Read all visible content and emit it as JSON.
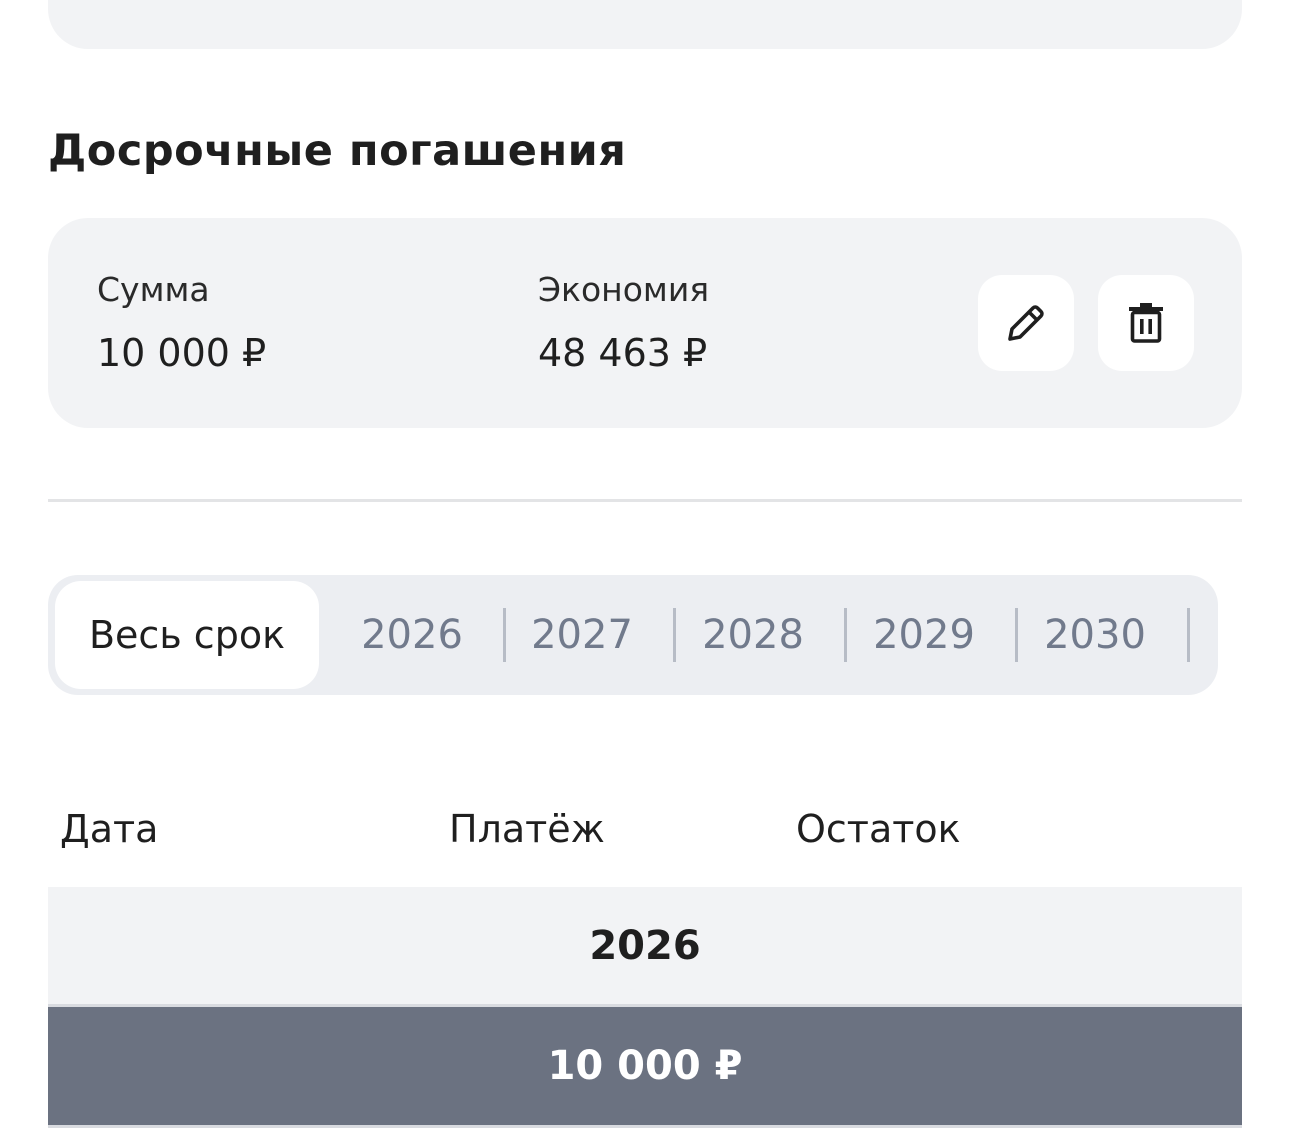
{
  "early_repayments": {
    "title": "Досрочные погашения",
    "card": {
      "sum_label": "Сумма",
      "sum_value": "10 000 ₽",
      "savings_label": "Экономия",
      "savings_value": "48 463 ₽",
      "edit_icon": "pencil-icon",
      "delete_icon": "trash-icon"
    }
  },
  "period_tabs": {
    "active": "Весь срок",
    "years": [
      "2026",
      "2027",
      "2028",
      "2029",
      "2030"
    ]
  },
  "schedule_table": {
    "headers": [
      "Дата",
      "Платёж",
      "Остаток"
    ],
    "group_year": "2026",
    "highlight_value": "10 000 ₽"
  },
  "colors": {
    "card_bg": "#f2f3f5",
    "tab_inactive_text": "#717a8c",
    "highlight_row_bg": "#6b7281"
  }
}
